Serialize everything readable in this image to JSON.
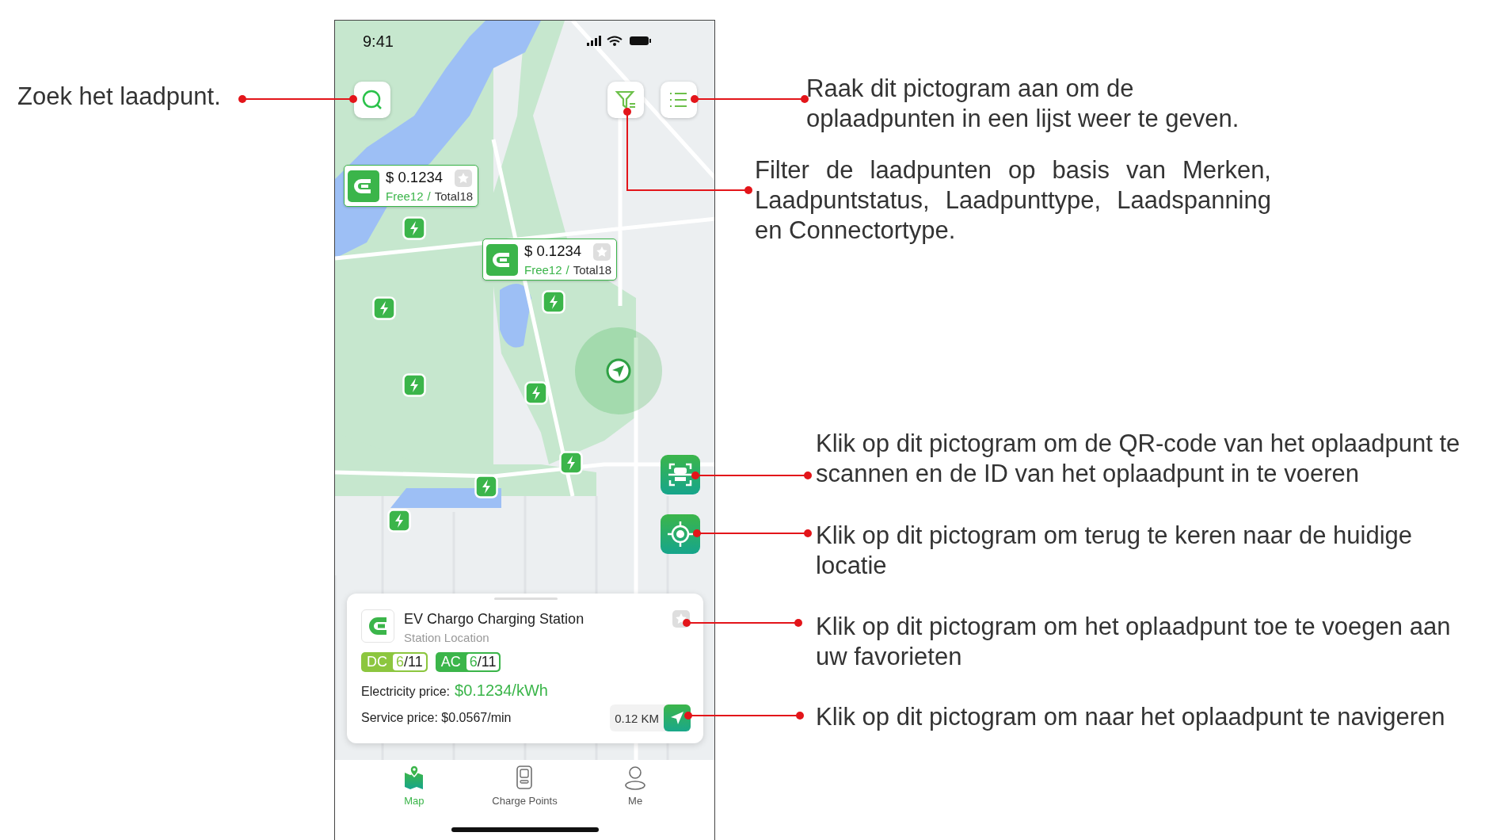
{
  "status_bar": {
    "time": "9:41"
  },
  "price_markers": [
    {
      "price": "$ 0.1234",
      "free": "Free12",
      "separator": "/",
      "total": "Total18",
      "favorite": false
    },
    {
      "price": "$ 0.1234",
      "free": "Free12",
      "separator": "/",
      "total": "Total18",
      "favorite": false
    }
  ],
  "station": {
    "name": "EV Chargo Charging Station",
    "location": "Station Location",
    "favorite": false,
    "connectors": [
      {
        "type": "DC",
        "available": "6",
        "capacity": "/11",
        "color": "#8cc63f"
      },
      {
        "type": "AC",
        "available": "6",
        "capacity": "/11",
        "color": "#3bb54a"
      }
    ],
    "electricity_label": "Electricity price:",
    "electricity_price": "$0.1234/kWh",
    "service_price": "Service price: $0.0567/min",
    "distance": "0.12 KM"
  },
  "tabs": [
    {
      "label": "Map",
      "selected": true
    },
    {
      "label": "Charge Points",
      "selected": false
    },
    {
      "label": "Me",
      "selected": false
    }
  ],
  "annotations": [
    {
      "kind": "search",
      "text": "Zoek het laadpunt."
    },
    {
      "kind": "list",
      "text": "Raak dit pictogram aan om de oplaadpunten in een lijst weer te geven."
    },
    {
      "kind": "filter",
      "text": "Filter de laadpunten op basis van Merken, Laadpuntstatus, Laadpunttype, Laadspanning en Connectortype."
    },
    {
      "kind": "scan",
      "text": "Klik op dit pictogram om de QR-code van het oplaadpunt te scannen en de ID van het oplaadpunt in te voeren"
    },
    {
      "kind": "locate",
      "text": "Klik op dit pictogram om terug te keren naar de huidige locatie"
    },
    {
      "kind": "favorite",
      "text": "Klik op dit pictogram om het oplaadpunt toe te voegen aan uw favorieten"
    },
    {
      "kind": "navigate",
      "text": "Klik op dit pictogram om naar het oplaadpunt te navigeren"
    }
  ]
}
